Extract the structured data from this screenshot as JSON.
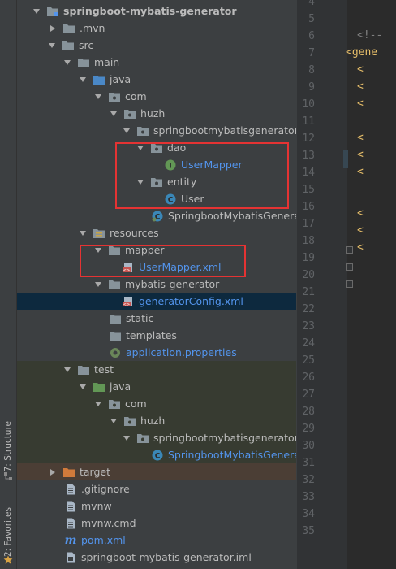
{
  "sidebar": {
    "structure_label": "7: Structure",
    "favorites_label": "2: Favorites"
  },
  "project_tree": {
    "root": "springboot-mybatis-generator",
    "mvn": ".mvn",
    "src": "src",
    "main": "main",
    "java": "java",
    "com": "com",
    "huzh": "huzh",
    "package": "springbootmybatisgenerator",
    "dao": "dao",
    "user_mapper": "UserMapper",
    "entity": "entity",
    "user": "User",
    "app_class": "SpringbootMybatisGenerat",
    "resources": "resources",
    "mapper": "mapper",
    "user_mapper_xml": "UserMapper.xml",
    "mybatis_generator": "mybatis-generator",
    "generator_config": "generatorConfig.xml",
    "static": "static",
    "templates": "templates",
    "application_properties": "application.properties",
    "test": "test",
    "test_java": "java",
    "test_com": "com",
    "test_huzh": "huzh",
    "test_package": "springbootmybatisgenerator",
    "test_class": "SpringbootMybatisGenerato",
    "target": "target",
    "gitignore": ".gitignore",
    "mvnw": "mvnw",
    "mvnw_cmd": "mvnw.cmd",
    "pom": "pom.xml",
    "iml": "springboot-mybatis-generator.iml"
  },
  "editor": {
    "line_numbers": [
      "4",
      "5",
      "6",
      "7",
      "8",
      "9",
      "10",
      "11",
      "12",
      "13",
      "14",
      "15",
      "16",
      "17",
      "18",
      "19",
      "20",
      "21",
      "22",
      "23",
      "24",
      "25",
      "26",
      "27",
      "28",
      "29",
      "30",
      "31",
      "32",
      "33",
      "34",
      "35"
    ],
    "comment_text": "<!--",
    "tag_text": "<gene"
  },
  "colors": {
    "highlight_box": "#e53333",
    "selected_row": "#0d293e",
    "test_folder_bg": "#373b31",
    "excluded_folder_bg": "#4b3e35",
    "link_blue": "#5394ec"
  }
}
